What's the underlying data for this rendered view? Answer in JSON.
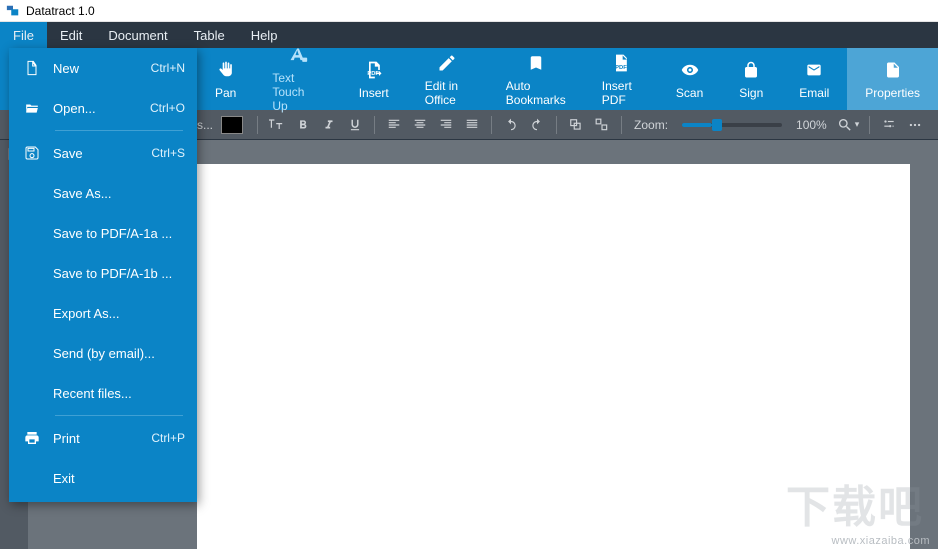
{
  "app": {
    "title": "Datatract 1.0"
  },
  "menubar": {
    "items": [
      {
        "label": "File",
        "active": true
      },
      {
        "label": "Edit",
        "active": false
      },
      {
        "label": "Document",
        "active": false
      },
      {
        "label": "Table",
        "active": false
      },
      {
        "label": "Help",
        "active": false
      }
    ]
  },
  "ribbon": {
    "items": [
      {
        "label": "Pan",
        "icon": "hand-icon"
      },
      {
        "label": "Text Touch Up",
        "icon": "text-touchup-icon",
        "selected": true
      },
      {
        "label": "Insert",
        "icon": "pdf-insert-icon"
      },
      {
        "label": "Edit in Office",
        "icon": "edit-office-icon"
      },
      {
        "label": "Auto Bookmarks",
        "icon": "bookmark-icon"
      },
      {
        "label": "Insert PDF",
        "icon": "pdf-icon"
      },
      {
        "label": "Scan",
        "icon": "eye-icon"
      },
      {
        "label": "Sign",
        "icon": "lock-icon"
      },
      {
        "label": "Email",
        "icon": "email-icon"
      },
      {
        "label": "Properties",
        "icon": "properties-icon",
        "highlight": true
      }
    ]
  },
  "toolbar2": {
    "truncated": "s...",
    "zoom_label": "Zoom:",
    "zoom_value": "100%",
    "zoom_percent": 30
  },
  "file_menu": {
    "items": [
      {
        "label": "New",
        "shortcut": "Ctrl+N",
        "icon": "new-file-icon"
      },
      {
        "label": "Open...",
        "shortcut": "Ctrl+O",
        "icon": "folder-open-icon"
      },
      {
        "sep": true
      },
      {
        "label": "Save",
        "shortcut": "Ctrl+S",
        "icon": "save-icon"
      },
      {
        "label": "Save As...",
        "shortcut": ""
      },
      {
        "label": "Save to PDF/A-1a ...",
        "shortcut": ""
      },
      {
        "label": "Save to PDF/A-1b ...",
        "shortcut": ""
      },
      {
        "label": "Export As...",
        "shortcut": ""
      },
      {
        "label": "Send (by email)...",
        "shortcut": ""
      },
      {
        "label": "Recent files...",
        "shortcut": ""
      },
      {
        "sep": true
      },
      {
        "label": "Print",
        "shortcut": "Ctrl+P",
        "icon": "print-icon"
      },
      {
        "label": "Exit",
        "shortcut": ""
      }
    ]
  },
  "watermark": {
    "big": "下载吧",
    "small": "www.xiazaiba.com"
  }
}
